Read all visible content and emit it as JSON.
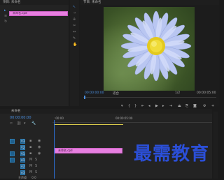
{
  "project": {
    "tab": "项目: 未命名",
    "clip_name": "未命名.cpd"
  },
  "program": {
    "tab": "节目: 未命名",
    "timecode_left": "00:00:00:00",
    "fit_label": "适合",
    "page": "1/2",
    "timecode_right": "00:00:05:00"
  },
  "timeline": {
    "tab": "未命名",
    "timecode": "00:00:00:00",
    "ruler_start": ":00:00",
    "ruler_mid": "00:00:05:00",
    "clip_label": "未命名.cpd",
    "tracks": [
      "V3",
      "V2",
      "V1",
      "A1",
      "A2",
      "A3"
    ],
    "master_label": "主声道",
    "master_value": "0.0"
  },
  "watermark": "最需教育",
  "colors": {
    "clip": "#e77fe0",
    "accent": "#4a8fe0",
    "playhead": "#2d6fd6"
  }
}
